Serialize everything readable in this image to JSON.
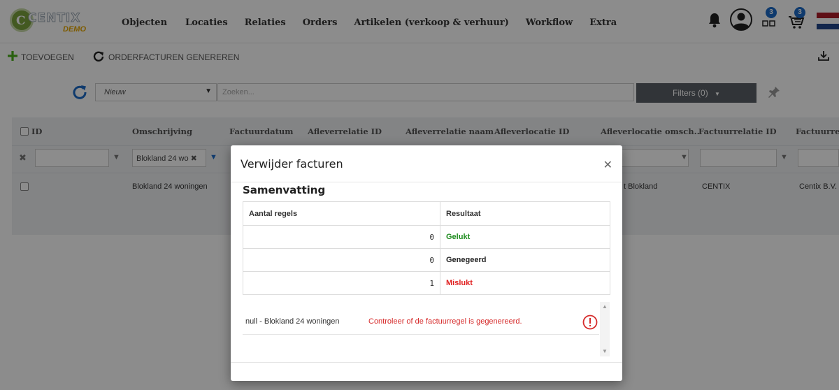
{
  "brand": {
    "name": "CENTIX",
    "badge": "DEMO"
  },
  "nav": [
    "Objecten",
    "Locaties",
    "Relaties",
    "Orders",
    "Artikelen (verkoop & verhuur)",
    "Workflow",
    "Extra"
  ],
  "notifications": {
    "tasks_count": "3",
    "cart_count": "3"
  },
  "toolbar": {
    "add_label": "TOEVOEGEN",
    "generate_label": "ORDERFACTUREN GENEREREN"
  },
  "filterbar": {
    "status_value": "Nieuw",
    "search_placeholder": "Zoeken...",
    "filters_label": "Filters (0)"
  },
  "grid": {
    "columns": [
      "ID",
      "Omschrijving",
      "Factuurdatum",
      "Afleverrelatie ID",
      "Afleverrelatie naam",
      "Afleverlocatie ID",
      "Afleverlocatie omsch..",
      "Factuurrelatie ID",
      "Factuurrela"
    ],
    "filter_omschrijving": "Blokland 24 wo",
    "row": {
      "omschrijving": "Blokland 24 woningen",
      "afleverlocatie_omsch": "t Blokland",
      "factuurrelatie_id": "CENTIX",
      "factuurrelatie_naam": "Centix B.V."
    }
  },
  "modal": {
    "title": "Verwijder facturen",
    "section_title": "Samenvatting",
    "table_headers": [
      "Aantal regels",
      "Resultaat"
    ],
    "rows": [
      {
        "count": "0",
        "result": "Gelukt",
        "color": "#1e8c1e"
      },
      {
        "count": "0",
        "result": "Genegeerd",
        "color": "#222222"
      },
      {
        "count": "1",
        "result": "Mislukt",
        "color": "#e02020"
      }
    ],
    "log": {
      "item": "null - Blokland 24 woningen",
      "message": "Controleer of de factuurregel is gegenereerd."
    }
  },
  "colors": {
    "accent_green": "#4caf1c",
    "accent_blue": "#1c6bc6",
    "error_red": "#d62b2b"
  }
}
